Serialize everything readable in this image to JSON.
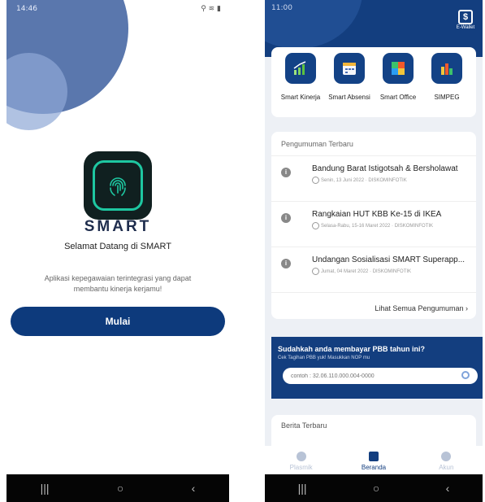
{
  "left": {
    "status": {
      "time": "14:46",
      "right": "⚲ ≋ ▮"
    },
    "logo_word": "SMART",
    "welcome": "Selamat Datang di SMART",
    "description": "Aplikasi kepegawaian terintegrasi yang dapat membantu kinerja kerjamu!",
    "start_button": "Mulai",
    "nav": {
      "recent": "|||",
      "home": "○",
      "back": "‹"
    }
  },
  "right": {
    "status": {
      "time": "11:00",
      "right": ""
    },
    "wallet_label": "E-Wallet",
    "menu": [
      {
        "label": "Smart Kinerja",
        "icon": "bar-chart-icon"
      },
      {
        "label": "Smart Absensi",
        "icon": "calendar-icon"
      },
      {
        "label": "Smart Office",
        "icon": "office-icon"
      },
      {
        "label": "SIMPEG",
        "icon": "data-icon"
      }
    ],
    "announcements": {
      "title": "Pengumuman Terbaru",
      "items": [
        {
          "title": "Bandung Barat Istigotsah & Bersholawat",
          "meta": "Senin, 13 Juni 2022 · DISKOMINFOTIK"
        },
        {
          "title": "Rangkaian HUT KBB Ke-15 di IKEA",
          "meta": "Selasa-Rabu, 15-16 Maret 2022 · DISKOMINFOTIK"
        },
        {
          "title": "Undangan Sosialisasi SMART Superapp...",
          "meta": "Jumat, 04 Maret 2022 · DISKOMINFOTIK"
        }
      ],
      "see_all": "Lihat Semua Pengumuman"
    },
    "pbb": {
      "title": "Sudahkah anda membayar PBB tahun ini?",
      "subtitle": "Cek Tagihan PBB yuk! Masukkan NOP mu",
      "placeholder": "contoh : 32.06.110.000.004-0000"
    },
    "berita": {
      "title": "Berita Terbaru"
    },
    "tabs": [
      {
        "label": "Plasmik",
        "color": "#b8c3d6"
      },
      {
        "label": "Beranda",
        "color": "#133e7f"
      },
      {
        "label": "Akun",
        "color": "#b8c3d6"
      }
    ],
    "nav": {
      "recent": "|||",
      "home": "○",
      "back": "‹"
    }
  },
  "colors": {
    "primary": "#133e7f",
    "accent": "#1ec7a1"
  }
}
